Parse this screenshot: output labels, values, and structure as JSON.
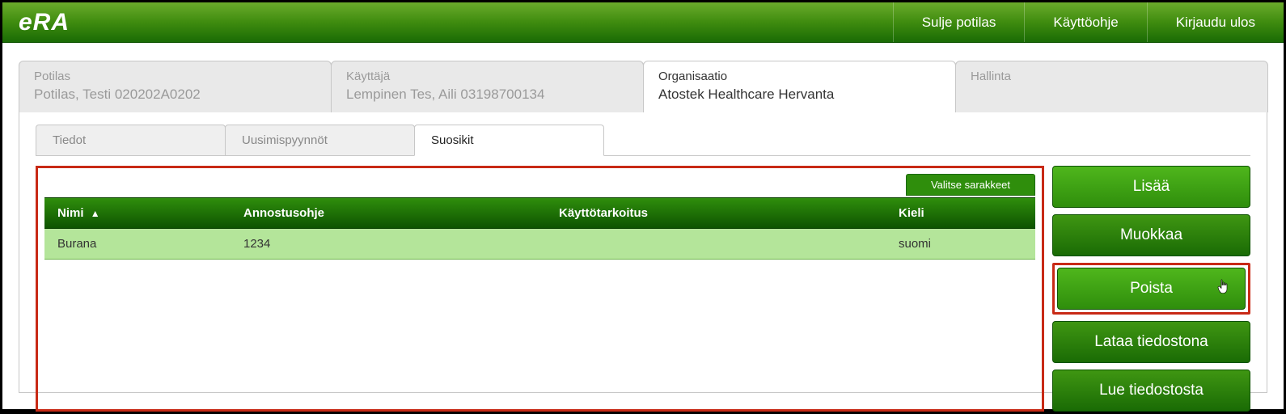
{
  "brand": "eRA",
  "header": {
    "close_patient": "Sulje potilas",
    "guide": "Käyttöohje",
    "logout": "Kirjaudu ulos"
  },
  "info_tabs": {
    "patient": {
      "label": "Potilas",
      "value": "Potilas, Testi 020202A0202"
    },
    "user": {
      "label": "Käyttäjä",
      "value": "Lempinen Tes, Aili 03198700134"
    },
    "org": {
      "label": "Organisaatio",
      "value": "Atostek Healthcare Hervanta"
    },
    "admin": {
      "label": "Hallinta"
    }
  },
  "sub_tabs": {
    "info": "Tiedot",
    "renewals": "Uusimispyynnöt",
    "favorites": "Suosikit"
  },
  "table": {
    "select_cols": "Valitse sarakkeet",
    "headers": {
      "name": "Nimi",
      "sort_indicator": "▲",
      "dosage": "Annostusohje",
      "purpose": "Käyttötarkoitus",
      "lang": "Kieli"
    },
    "rows": [
      {
        "name": "Burana",
        "dosage": "1234",
        "purpose": "",
        "lang": "suomi"
      }
    ]
  },
  "actions": {
    "add": "Lisää",
    "edit": "Muokkaa",
    "delete": "Poista",
    "download": "Lataa tiedostona",
    "read": "Lue tiedostosta"
  }
}
